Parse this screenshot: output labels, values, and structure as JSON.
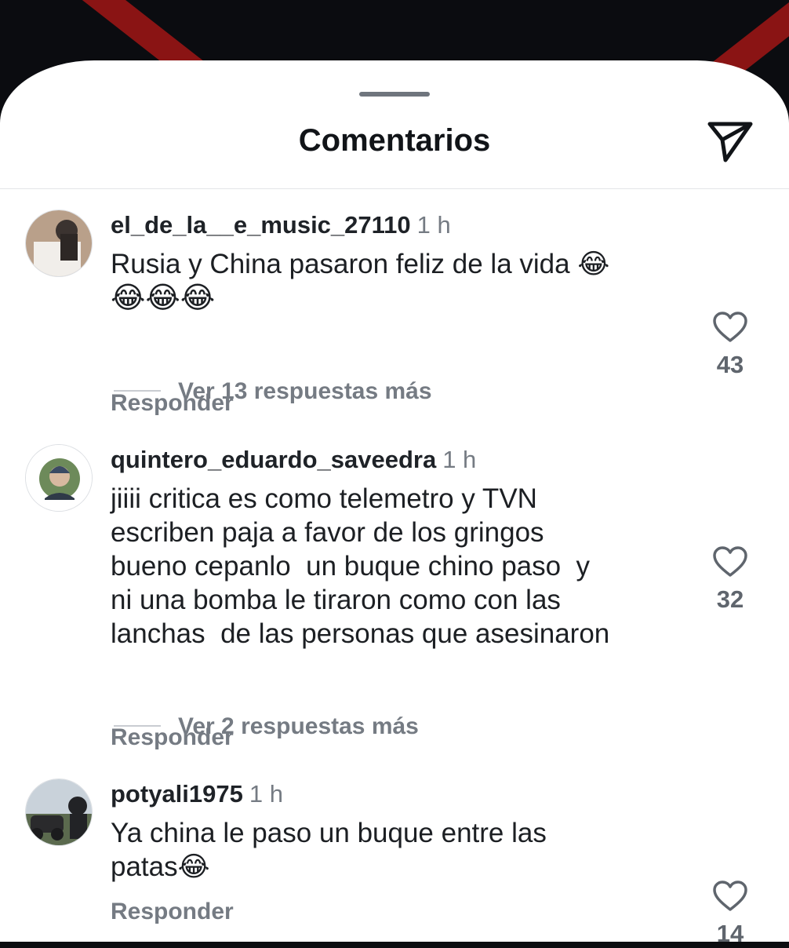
{
  "header": {
    "title": "Comentarios"
  },
  "comments": [
    {
      "username": "el_de_la__e_music_27110",
      "time": "1 h",
      "text_line1": "Rusia y China pasaron feliz de la vida 😂",
      "text_line2": "😂😂😂",
      "likes": "43",
      "reply_label": "Responder",
      "more_replies": "Ver 13 respuestas más"
    },
    {
      "username": "quintero_eduardo_saveedra",
      "time": "1 h",
      "text_line1": "jiiii critica es como telemetro y TVN",
      "text_line2": "escriben paja a favor de los gringos",
      "text_line3": "bueno cepanlo  un buque chino paso  y",
      "text_line4": "ni una bomba le tiraron como con las",
      "text_line5": "lanchas  de las personas que asesinaron",
      "likes": "32",
      "reply_label": "Responder",
      "more_replies": "Ver 2 respuestas más"
    },
    {
      "username": "potyali1975",
      "time": "1 h",
      "text_line1": "Ya china le paso un buque entre las",
      "text_line2": "patas😂",
      "likes": "14",
      "reply_label": "Responder"
    }
  ],
  "icons": {
    "share": "paper-plane-icon",
    "like": "heart-icon"
  },
  "colors": {
    "primary_text": "#1c1f23",
    "secondary_text": "#757b83",
    "backdrop": "#0b0c10",
    "accent_red": "#8a1414"
  }
}
